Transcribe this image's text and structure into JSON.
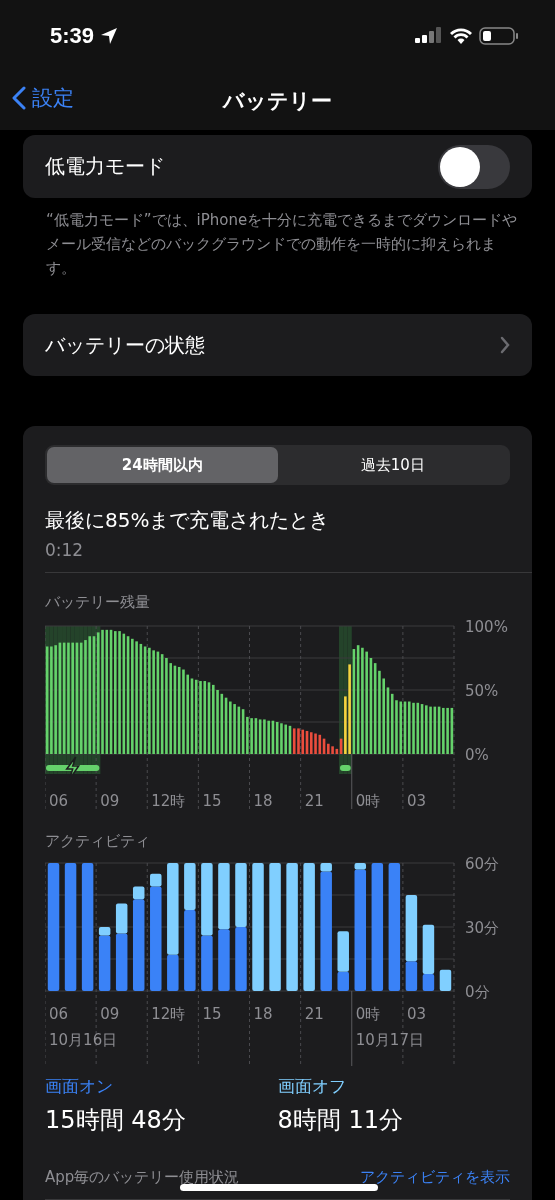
{
  "status_bar": {
    "time": "5:39"
  },
  "nav": {
    "back": "設定",
    "title": "バッテリー"
  },
  "low_power": {
    "label": "低電力モード",
    "on": false,
    "footnote": "“低電力モード”では、iPhoneを十分に充電できるまでダウンロードやメール受信などのバックグラウンドでの動作を一時的に抑えられます。"
  },
  "battery_health": {
    "label": "バッテリーの状態"
  },
  "usage": {
    "tabs": [
      {
        "label": "24時間以内",
        "selected": true
      },
      {
        "label": "過去10日",
        "selected": false
      }
    ],
    "last_charge": {
      "title": "最後に85%まで充電されたとき",
      "time": "0:12"
    },
    "battery_level": {
      "chart_data": {
        "type": "bar",
        "title": "バッテリー残量",
        "ylim": [
          0,
          100
        ],
        "yticks": [
          {
            "value": 0,
            "label": "0%"
          },
          {
            "value": 50,
            "label": "50%"
          },
          {
            "value": 100,
            "label": "100%"
          }
        ],
        "series": [
          {
            "color": "#65d26b",
            "values": [
              84,
              84,
              85,
              87,
              87,
              87,
              87,
              87,
              87,
              89,
              92,
              92,
              95,
              97,
              97,
              97,
              96,
              96,
              94,
              92,
              90,
              88,
              86,
              84,
              83,
              81,
              80,
              78,
              75,
              71,
              69,
              68,
              66,
              62,
              59,
              58,
              57,
              57,
              56,
              54,
              50,
              47,
              44,
              41,
              39,
              37,
              35,
              29,
              28,
              28,
              27,
              27,
              26,
              26,
              25,
              24,
              23,
              22,
              null,
              null,
              null,
              null,
              null,
              null,
              null,
              null,
              null,
              null,
              null,
              null,
              null,
              null,
              82,
              85,
              83,
              80,
              75,
              71,
              65,
              59,
              52,
              47,
              42,
              41,
              41,
              41,
              40,
              40,
              39,
              38,
              37,
              37,
              37,
              36,
              36,
              36
            ]
          },
          {
            "color": "#eb4d3d",
            "values": [
              null,
              null,
              null,
              null,
              null,
              null,
              null,
              null,
              null,
              null,
              null,
              null,
              null,
              null,
              null,
              null,
              null,
              null,
              null,
              null,
              null,
              null,
              null,
              null,
              null,
              null,
              null,
              null,
              null,
              null,
              null,
              null,
              null,
              null,
              null,
              null,
              null,
              null,
              null,
              null,
              null,
              null,
              null,
              null,
              null,
              null,
              null,
              null,
              null,
              null,
              null,
              null,
              null,
              null,
              null,
              null,
              null,
              null,
              20,
              20,
              19,
              18,
              17,
              16,
              15,
              12,
              8,
              6,
              4,
              12,
              null,
              null,
              null,
              null,
              null,
              null,
              null,
              null,
              null,
              null,
              null,
              null,
              null,
              null,
              null,
              null,
              null,
              null,
              null,
              null,
              null,
              null,
              null,
              null,
              null,
              null
            ]
          },
          {
            "color": "#f5d33f",
            "values": [
              null,
              null,
              null,
              null,
              null,
              null,
              null,
              null,
              null,
              null,
              null,
              null,
              null,
              null,
              null,
              null,
              null,
              null,
              null,
              null,
              null,
              null,
              null,
              null,
              null,
              null,
              null,
              null,
              null,
              null,
              null,
              null,
              null,
              null,
              null,
              null,
              null,
              null,
              null,
              null,
              null,
              null,
              null,
              null,
              null,
              null,
              null,
              null,
              null,
              null,
              null,
              null,
              null,
              null,
              null,
              null,
              null,
              null,
              null,
              null,
              null,
              null,
              null,
              null,
              null,
              null,
              null,
              null,
              null,
              null,
              45,
              70,
              null,
              null,
              null,
              null,
              null,
              null,
              null,
              null,
              null,
              null,
              null,
              null,
              null,
              null,
              null,
              null,
              null,
              null,
              null,
              null,
              null,
              null,
              null,
              null
            ]
          }
        ]
      },
      "charging": [
        true,
        true,
        true,
        true,
        true,
        true,
        true,
        true,
        true,
        true,
        true,
        true,
        true,
        false,
        false,
        false,
        false,
        false,
        false,
        false,
        false,
        false,
        false,
        false,
        false,
        false,
        false,
        false,
        false,
        false,
        false,
        false,
        false,
        false,
        false,
        false,
        false,
        false,
        false,
        false,
        false,
        false,
        false,
        false,
        false,
        false,
        false,
        false,
        false,
        false,
        false,
        false,
        false,
        false,
        false,
        false,
        false,
        false,
        false,
        false,
        false,
        false,
        false,
        false,
        false,
        false,
        false,
        false,
        false,
        true,
        true,
        true,
        false,
        false,
        false,
        false,
        false,
        false,
        false,
        false,
        false,
        false,
        false,
        false,
        false,
        false,
        false,
        false,
        false,
        false,
        false,
        false,
        false,
        false,
        false,
        false
      ],
      "time_labels": [
        {
          "label": "06"
        },
        {
          "label": "09"
        },
        {
          "label": "12時"
        },
        {
          "label": "15"
        },
        {
          "label": "18"
        },
        {
          "label": "21"
        },
        {
          "label": "0時"
        },
        {
          "label": "03"
        }
      ]
    },
    "activity": {
      "chart_data": {
        "type": "bar",
        "title": "アクティビティ",
        "stacked": true,
        "ylim": [
          0,
          60
        ],
        "yticks": [
          {
            "value": 0,
            "label": "0分"
          },
          {
            "value": 30,
            "label": "30分"
          },
          {
            "value": 60,
            "label": "60分"
          }
        ],
        "series": [
          {
            "name": "画面オン",
            "color": "#3a82f7",
            "values": [
              60,
              60,
              60,
              26,
              27,
              43,
              49,
              17,
              38,
              26,
              29,
              30,
              0,
              0,
              0,
              0,
              56,
              9,
              57,
              60,
              60,
              14,
              8,
              0
            ]
          },
          {
            "name": "画面オフ",
            "color": "#80cfff",
            "values": [
              0,
              0,
              0,
              4,
              14,
              6,
              6,
              43,
              22,
              34,
              31,
              30,
              60,
              60,
              60,
              60,
              4,
              19,
              3,
              0,
              0,
              31,
              23,
              10
            ]
          }
        ]
      },
      "time_labels": [
        {
          "label": "06",
          "date": "10月16日"
        },
        {
          "label": "09"
        },
        {
          "label": "12時"
        },
        {
          "label": "15"
        },
        {
          "label": "18"
        },
        {
          "label": "21"
        },
        {
          "label": "0時",
          "date": "10月17日"
        },
        {
          "label": "03"
        }
      ]
    },
    "screen_on": {
      "value": "15時間 48分"
    },
    "screen_off": {
      "value": "8時間 11分"
    },
    "app_usage": {
      "title": "App毎のバッテリー使用状況",
      "link": "アクティビティを表示"
    }
  }
}
